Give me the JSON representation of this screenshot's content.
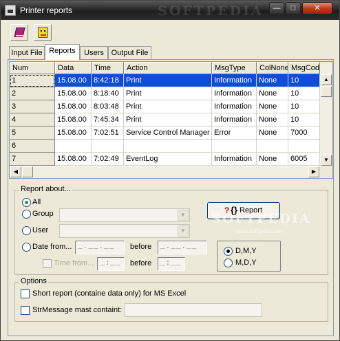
{
  "window": {
    "title": "Printer reports",
    "watermark": "SOFTPEDIA"
  },
  "tabs": [
    "Input File",
    "Reports",
    "Users",
    "Output File"
  ],
  "grid": {
    "columns": [
      "Num",
      "Data",
      "Time",
      "Action",
      "MsgType",
      "ColNone",
      "MsgCod"
    ],
    "rows": [
      [
        "1",
        "15.08.00",
        "8:42:18",
        "Print",
        "Information",
        "None",
        "10"
      ],
      [
        "2",
        "15.08.00",
        "8:18:40",
        "Print",
        "Information",
        "None",
        "10"
      ],
      [
        "3",
        "15.08.00",
        "8:03:48",
        "Print",
        "Information",
        "None",
        "10"
      ],
      [
        "4",
        "15.08.00",
        "7:45:34",
        "Print",
        "Information",
        "None",
        "10"
      ],
      [
        "5",
        "15.08.00",
        "7:02:51",
        "Service Control Manager",
        "Error",
        "None",
        "7000"
      ],
      [
        "6",
        "",
        "",
        "",
        "",
        "",
        ""
      ],
      [
        "7",
        "15.08.00",
        "7:02:49",
        "EventLog",
        "Information",
        "None",
        "6005"
      ]
    ]
  },
  "report": {
    "group_label": "Report about...",
    "all": "All",
    "group": "Group",
    "user": "User",
    "date_from": "Date from...",
    "time_from": "Time from...",
    "before": "before",
    "date_mask": "_.__.__",
    "time_mask": "_:__",
    "button": {
      "icon_q": "?",
      "icon_br": "{}",
      "label": "Report"
    },
    "order": [
      "D,M,Y",
      "M,D,Y"
    ]
  },
  "options": {
    "group_label": "Options",
    "short_report": "Short report (containe data only) for MS Excel",
    "str_message": "StrMessage mast containt:"
  },
  "watermark_bottom": "SOFTPEDIA",
  "watermark_url": "www.softpedia.com"
}
